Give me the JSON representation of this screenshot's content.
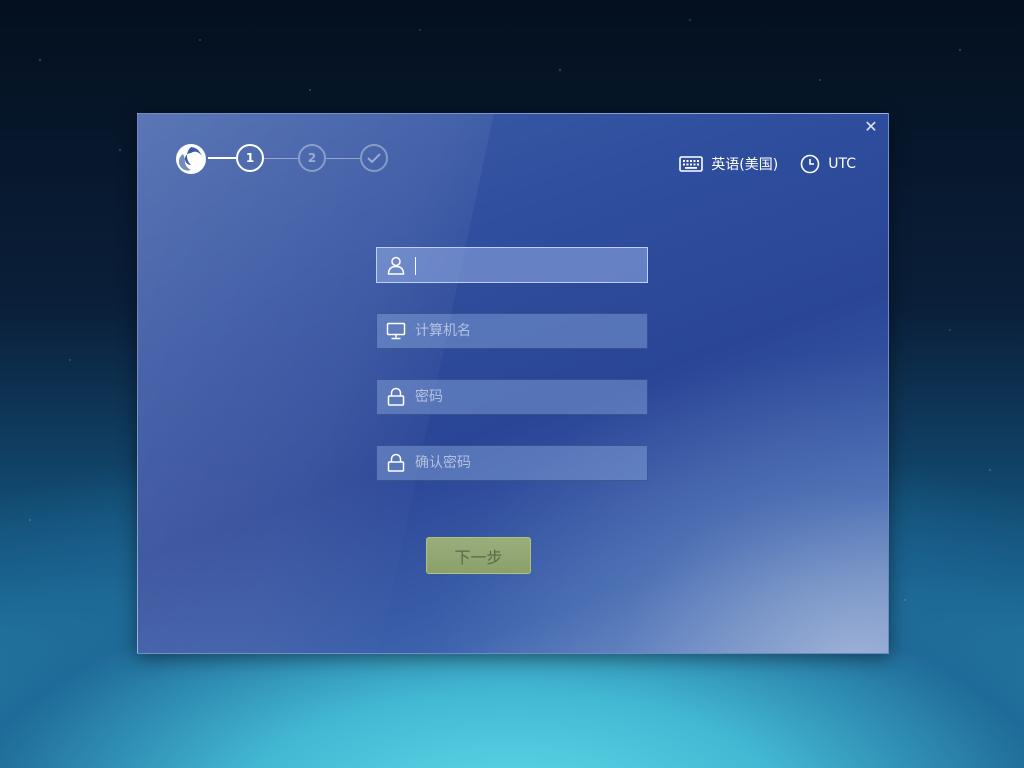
{
  "window": {
    "close_label": "✕"
  },
  "steps": [
    {
      "label": "1",
      "state": "active"
    },
    {
      "label": "2",
      "state": "inactive"
    },
    {
      "label": "",
      "state": "inactive",
      "icon": "check-icon"
    }
  ],
  "topbar": {
    "keyboard_layout": "英语(美国)",
    "timezone": "UTC"
  },
  "form": {
    "username": {
      "value": "",
      "placeholder": "",
      "icon": "user-icon"
    },
    "hostname": {
      "value": "",
      "placeholder": "计算机名",
      "icon": "computer-icon"
    },
    "password": {
      "value": "",
      "placeholder": "密码",
      "icon": "lock-icon"
    },
    "confirm_password": {
      "value": "",
      "placeholder": "确认密码",
      "icon": "lock-icon"
    }
  },
  "next_button": {
    "label": "下一步"
  },
  "colors": {
    "dialog": "#2f4e9e",
    "button": "#8ba06a",
    "desktop_glow": "#5fd9e8"
  }
}
